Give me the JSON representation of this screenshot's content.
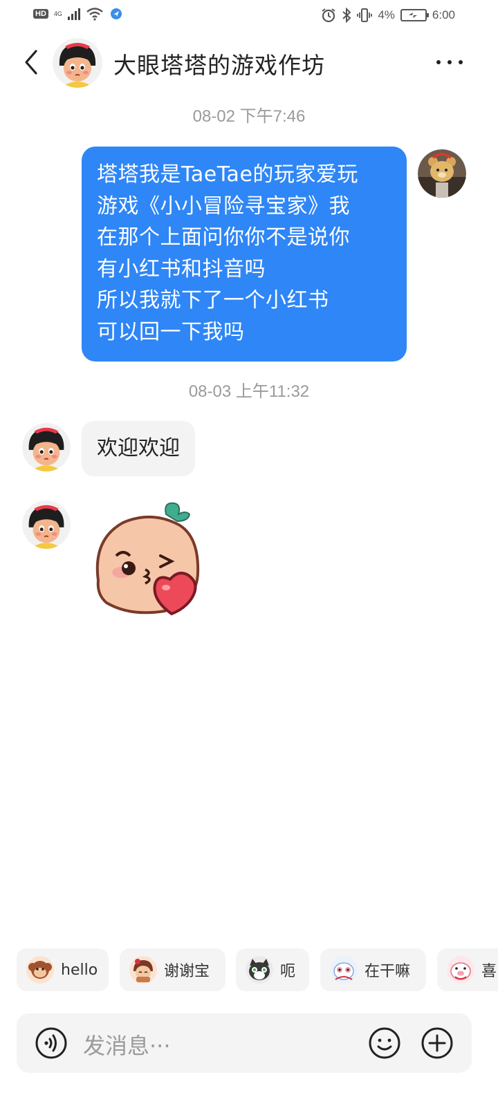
{
  "status_bar": {
    "left_badge": "HD",
    "network": "4G",
    "battery_percent": "4%",
    "time": "6:00"
  },
  "header": {
    "title": "大眼塔塔的游戏作坊"
  },
  "messages": {
    "timestamp_1": "08-02 下午7:46",
    "outgoing_1": "塔塔我是TaeTae的玩家爱玩\n游戏《小小冒险寻宝家》我\n在那个上面问你你不是说你\n有小红书和抖音吗\n所以我就下了一个小红书\n可以回一下我吗",
    "timestamp_2": "08-03 上午11:32",
    "incoming_1": "欢迎欢迎"
  },
  "quick_replies": [
    {
      "label": "hello",
      "icon": "monkey-sticker-icon"
    },
    {
      "label": "谢谢宝",
      "icon": "girl-sticker-icon"
    },
    {
      "label": "呃",
      "icon": "cat-sticker-icon"
    },
    {
      "label": "在干嘛",
      "icon": "bunny-sticker-icon"
    },
    {
      "label": "喜",
      "icon": "pig-sticker-icon"
    }
  ],
  "input": {
    "placeholder": "发消息···"
  },
  "colors": {
    "outgoing_bubble": "#2f86f6",
    "incoming_bubble": "#f3f3f3",
    "timestamp": "#9a9a9a"
  }
}
